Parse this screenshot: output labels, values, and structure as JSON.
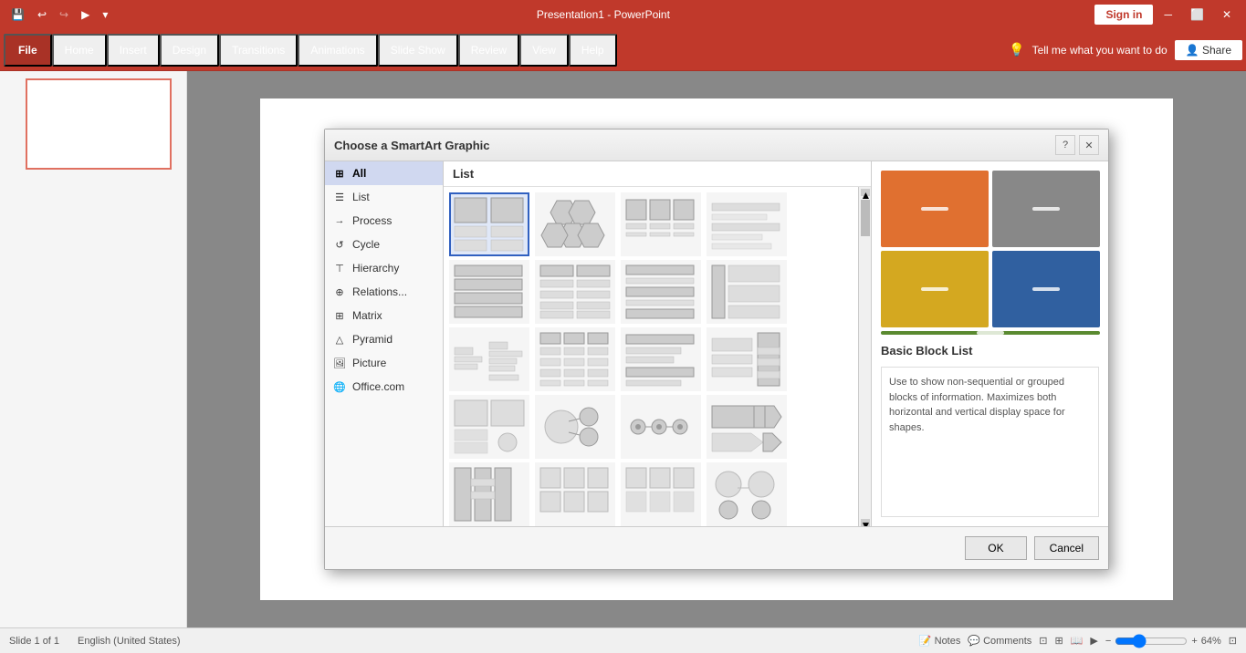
{
  "titlebar": {
    "title": "Presentation1 - PowerPoint",
    "signin_label": "Sign in"
  },
  "ribbon": {
    "tabs": [
      "File",
      "Home",
      "Insert",
      "Design",
      "Transitions",
      "Animations",
      "Slide Show",
      "Review",
      "View",
      "Help"
    ],
    "search_placeholder": "Tell me what you want to do",
    "share_label": "Share"
  },
  "dialog": {
    "title": "Choose a SmartArt Graphic",
    "category_header": "List",
    "categories": [
      {
        "id": "all",
        "label": "All"
      },
      {
        "id": "list",
        "label": "List"
      },
      {
        "id": "process",
        "label": "Process"
      },
      {
        "id": "cycle",
        "label": "Cycle"
      },
      {
        "id": "hierarchy",
        "label": "Hierarchy"
      },
      {
        "id": "relations",
        "label": "Relations..."
      },
      {
        "id": "matrix",
        "label": "Matrix"
      },
      {
        "id": "pyramid",
        "label": "Pyramid"
      },
      {
        "id": "picture",
        "label": "Picture"
      },
      {
        "id": "officecom",
        "label": "Office.com"
      }
    ],
    "preview": {
      "title": "Basic Block List",
      "description": "Use to show non-sequential or grouped blocks of information. Maximizes both horizontal and vertical display space for shapes."
    },
    "ok_label": "OK",
    "cancel_label": "Cancel"
  },
  "statusbar": {
    "slide_info": "Slide 1 of 1",
    "language": "English (United States)",
    "notes_label": "Notes",
    "comments_label": "Comments",
    "zoom_level": "64%"
  }
}
